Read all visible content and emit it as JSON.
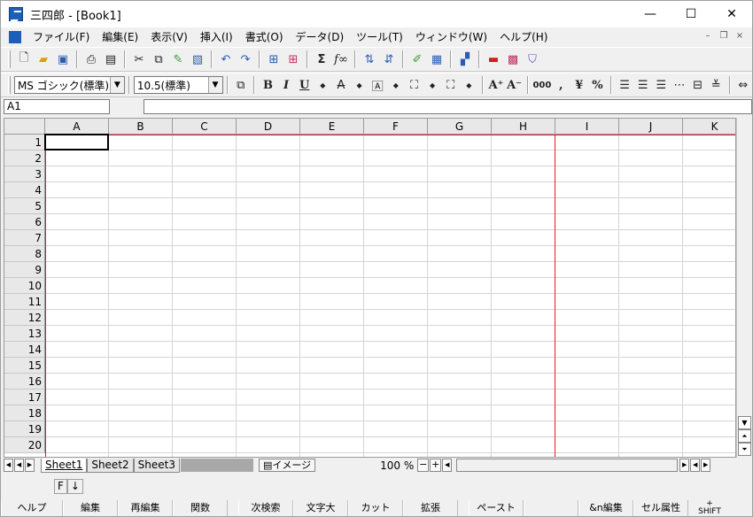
{
  "window": {
    "title": "三四郎 - [Book1]",
    "minimize": "—",
    "maximize": "☐",
    "close": "✕"
  },
  "menu": [
    "ファイル(F)",
    "編集(E)",
    "表示(V)",
    "挿入(I)",
    "書式(O)",
    "データ(D)",
    "ツール(T)",
    "ウィンドウ(W)",
    "ヘルプ(H)"
  ],
  "mdi": {
    "minimize": "–",
    "restore": "❐",
    "close": "×"
  },
  "toolbar2": {
    "font": "MS ゴシック(標準)",
    "size": "10.5(標準)",
    "bold": "B",
    "italic": "I",
    "underline": "U",
    "thousands": "000",
    "comma": ",",
    "yen": "¥",
    "percent": "%"
  },
  "formula": {
    "cell_ref": "A1",
    "content": ""
  },
  "columns": [
    "A",
    "B",
    "C",
    "D",
    "E",
    "F",
    "G",
    "H",
    "I",
    "J",
    "K"
  ],
  "rows": [
    "1",
    "2",
    "3",
    "4",
    "5",
    "6",
    "7",
    "8",
    "9",
    "10",
    "11",
    "12",
    "13",
    "14",
    "15",
    "16",
    "17",
    "18",
    "19",
    "20"
  ],
  "sheets": [
    "Sheet1",
    "Sheet2",
    "Sheet3"
  ],
  "active_sheet": "Sheet1",
  "image_button": "イメージ",
  "zoom": {
    "value": "100 %",
    "minus": "−",
    "plus": "+"
  },
  "status": {
    "mode": "F",
    "arrow": "↓"
  },
  "fkeys": [
    "ヘルプ",
    "編集",
    "再編集",
    "関数",
    "次検索",
    "文字大",
    "カット",
    "拡張",
    "ペースト",
    "",
    "&n編集",
    "セル属性"
  ],
  "shift": {
    "top": "+",
    "label": "SHIFT"
  },
  "colors": {
    "page_break": "#e02020",
    "active_cell_border": "#000000"
  }
}
